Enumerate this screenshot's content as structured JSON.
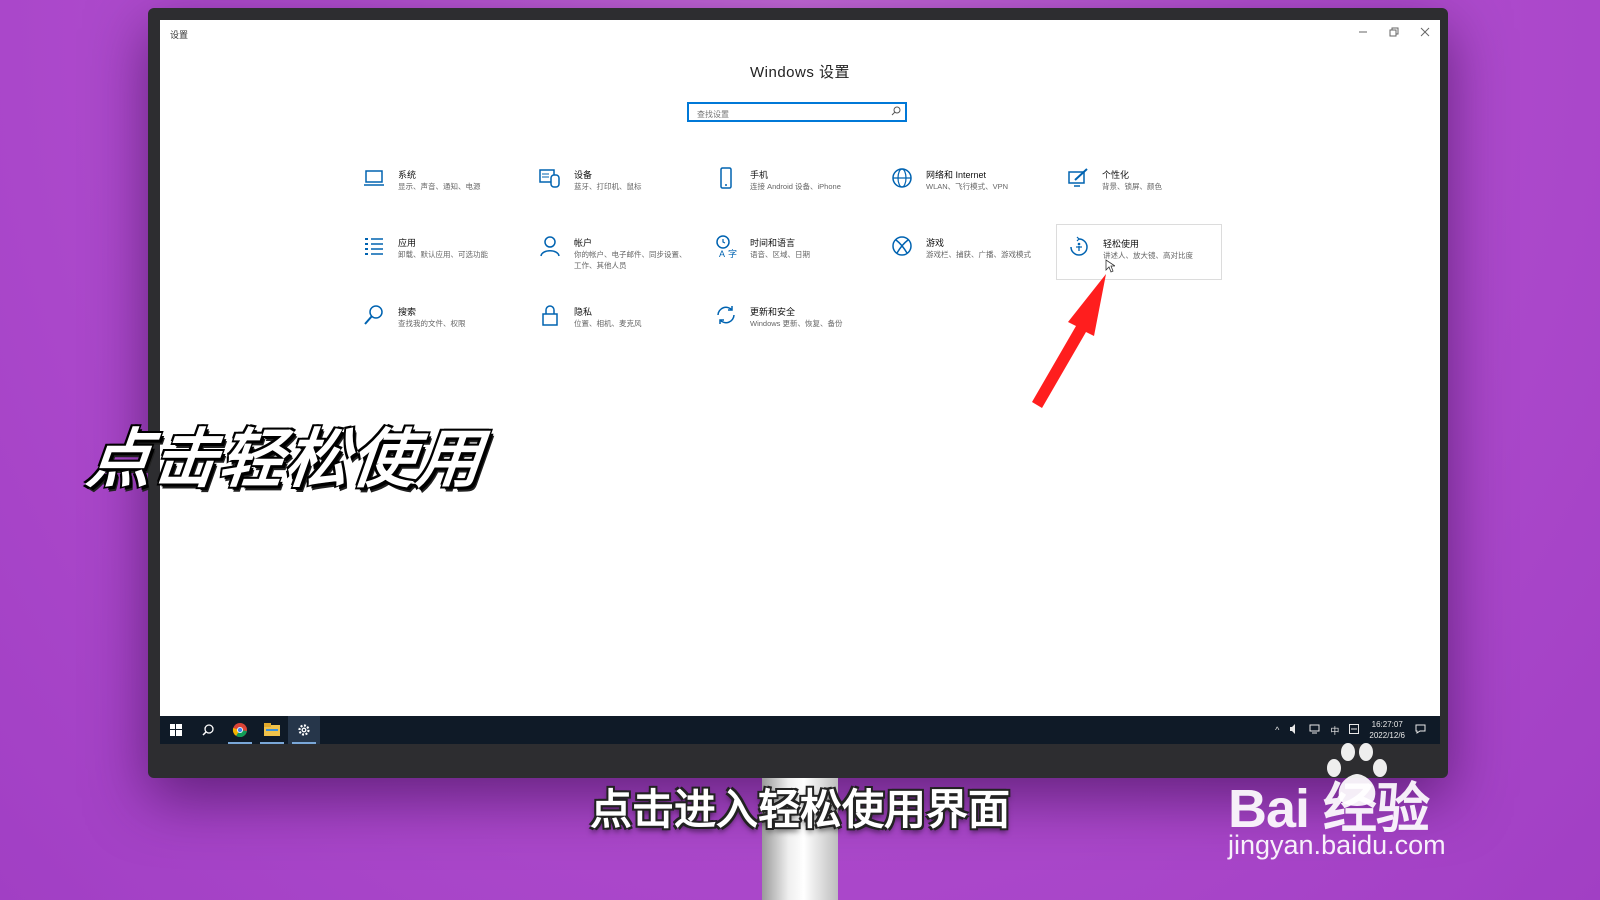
{
  "window": {
    "title": "设置",
    "controls": [
      "minimize",
      "restore",
      "close"
    ]
  },
  "page": {
    "title": "Windows 设置"
  },
  "search": {
    "placeholder": "查找设置",
    "icon": "search-icon"
  },
  "tiles": [
    {
      "name": "系统",
      "desc": "显示、声音、通知、电源",
      "icon": "laptop-icon"
    },
    {
      "name": "设备",
      "desc": "蓝牙、打印机、鼠标",
      "icon": "keyboard-icon"
    },
    {
      "name": "手机",
      "desc": "连接 Android 设备、iPhone",
      "icon": "phone-icon"
    },
    {
      "name": "网络和 Internet",
      "desc": "WLAN、飞行模式、VPN",
      "icon": "globe-icon"
    },
    {
      "name": "个性化",
      "desc": "背景、锁屏、颜色",
      "icon": "paint-icon"
    },
    {
      "name": "应用",
      "desc": "卸载、默认应用、可选功能",
      "icon": "apps-list-icon"
    },
    {
      "name": "帐户",
      "desc": "你的帐户、电子邮件、同步设置、工作、其他人员",
      "icon": "person-icon"
    },
    {
      "name": "时间和语言",
      "desc": "语音、区域、日期",
      "icon": "time-language-icon"
    },
    {
      "name": "游戏",
      "desc": "游戏栏、捕获、广播、游戏模式",
      "icon": "xbox-icon"
    },
    {
      "name": "轻松使用",
      "desc": "讲述人、放大镜、高对比度",
      "icon": "ease-of-access-icon"
    },
    {
      "name": "搜索",
      "desc": "查找我的文件、权限",
      "icon": "search-icon"
    },
    {
      "name": "隐私",
      "desc": "位置、相机、麦克风",
      "icon": "lock-icon"
    },
    {
      "name": "更新和安全",
      "desc": "Windows 更新、恢复、备份",
      "icon": "sync-icon"
    }
  ],
  "taskbar": {
    "apps": [
      "windows-start-icon",
      "search-icon",
      "chrome-icon",
      "file-explorer-icon",
      "settings-gear-icon"
    ],
    "tray": {
      "ime": "中",
      "time": "16:27:07",
      "date": "2022/12/6"
    }
  },
  "captions": {
    "big": "点击轻松使用",
    "sub": "点击进入轻松使用界面"
  },
  "watermark": {
    "logo": "Bai 经验",
    "url": "jingyan.baidu.com"
  },
  "colors": {
    "accent": "#0078d7",
    "icon_blue": "#0063b1",
    "taskbar": "#0f1a27",
    "arrow": "#ff1e1e",
    "background": "#b34fd0"
  }
}
